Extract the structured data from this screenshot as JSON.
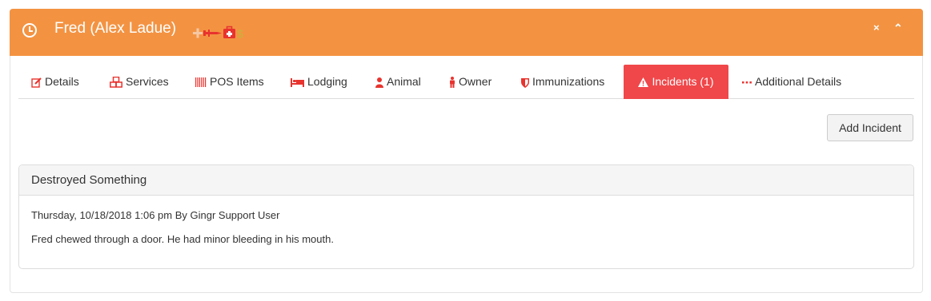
{
  "header": {
    "title": "Fred (Alex Ladue)",
    "background_color": "#f39342",
    "icons": [
      "clock-icon",
      "plus-cross-icon",
      "syringe-icon",
      "first-aid-kit-icon",
      "dollar-icon"
    ],
    "close_glyph": "×",
    "collapse_glyph": "⌃"
  },
  "tabs": [
    {
      "label": "Details",
      "icon": "edit-icon",
      "active": false
    },
    {
      "label": "Services",
      "icon": "cubes-icon",
      "active": false
    },
    {
      "label": "POS Items",
      "icon": "barcode-icon",
      "active": false
    },
    {
      "label": "Lodging",
      "icon": "bed-icon",
      "active": false
    },
    {
      "label": "Animal",
      "icon": "user-icon",
      "active": false
    },
    {
      "label": "Owner",
      "icon": "person-icon",
      "active": false
    },
    {
      "label": "Immunizations",
      "icon": "shield-icon",
      "active": false
    },
    {
      "label": "Incidents (1)",
      "icon": "warning-icon",
      "active": true
    },
    {
      "label": "Additional Details",
      "icon": "ellipsis-icon",
      "active": false
    }
  ],
  "accent_color": "#f0474a",
  "actions": {
    "add_incident_label": "Add Incident"
  },
  "incident": {
    "title": "Destroyed Something",
    "meta": "Thursday, 10/18/2018 1:06 pm By Gingr Support User",
    "description": "Fred chewed through a door. He had minor bleeding in his mouth."
  }
}
